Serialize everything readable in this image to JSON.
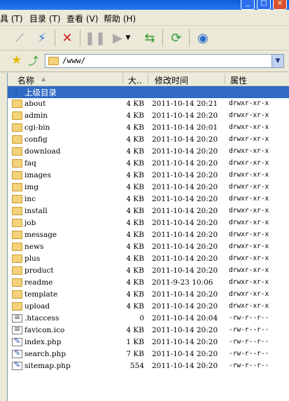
{
  "menu": [
    "具 (T)",
    "目录 (T)",
    "查看 (V)",
    "帮助 (H)"
  ],
  "address": {
    "path": "/www/"
  },
  "columns": {
    "name": "名称",
    "size": "大..",
    "time": "修改时间",
    "attr": "属性"
  },
  "parent_label": "上级目录",
  "files": [
    {
      "name": "about",
      "size": "4 KB",
      "time": "2011-10-14 20:21",
      "attr": "drwxr-xr-x",
      "type": "folder"
    },
    {
      "name": "admin",
      "size": "4 KB",
      "time": "2011-10-14 20:20",
      "attr": "drwxr-xr-x",
      "type": "folder"
    },
    {
      "name": "cgi-bin",
      "size": "4 KB",
      "time": "2011-10-14 20:01",
      "attr": "drwxr-xr-x",
      "type": "folder"
    },
    {
      "name": "config",
      "size": "4 KB",
      "time": "2011-10-14 20:20",
      "attr": "drwxr-xr-x",
      "type": "folder"
    },
    {
      "name": "download",
      "size": "4 KB",
      "time": "2011-10-14 20:20",
      "attr": "drwxr-xr-x",
      "type": "folder"
    },
    {
      "name": "faq",
      "size": "4 KB",
      "time": "2011-10-14 20:20",
      "attr": "drwxr-xr-x",
      "type": "folder"
    },
    {
      "name": "images",
      "size": "4 KB",
      "time": "2011-10-14 20:20",
      "attr": "drwxr-xr-x",
      "type": "folder"
    },
    {
      "name": "img",
      "size": "4 KB",
      "time": "2011-10-14 20:20",
      "attr": "drwxr-xr-x",
      "type": "folder"
    },
    {
      "name": "inc",
      "size": "4 KB",
      "time": "2011-10-14 20:20",
      "attr": "drwxr-xr-x",
      "type": "folder"
    },
    {
      "name": "install",
      "size": "4 KB",
      "time": "2011-10-14 20:20",
      "attr": "drwxr-xr-x",
      "type": "folder"
    },
    {
      "name": "job",
      "size": "4 KB",
      "time": "2011-10-14 20:20",
      "attr": "drwxr-xr-x",
      "type": "folder"
    },
    {
      "name": "message",
      "size": "4 KB",
      "time": "2011-10-14 20:20",
      "attr": "drwxr-xr-x",
      "type": "folder"
    },
    {
      "name": "news",
      "size": "4 KB",
      "time": "2011-10-14 20:20",
      "attr": "drwxr-xr-x",
      "type": "folder"
    },
    {
      "name": "plus",
      "size": "4 KB",
      "time": "2011-10-14 20:20",
      "attr": "drwxr-xr-x",
      "type": "folder"
    },
    {
      "name": "product",
      "size": "4 KB",
      "time": "2011-10-14 20:20",
      "attr": "drwxr-xr-x",
      "type": "folder"
    },
    {
      "name": "readme",
      "size": "4 KB",
      "time": "2011-9-23 10:06",
      "attr": "drwxr-xr-x",
      "type": "folder"
    },
    {
      "name": "template",
      "size": "4 KB",
      "time": "2011-10-14 20:20",
      "attr": "drwxr-xr-x",
      "type": "folder"
    },
    {
      "name": "upload",
      "size": "4 KB",
      "time": "2011-10-14 20:20",
      "attr": "drwxr-xr-x",
      "type": "folder"
    },
    {
      "name": ".htaccess",
      "size": "0",
      "time": "2011-10-14 20:04",
      "attr": "-rw-r--r--",
      "type": "txt"
    },
    {
      "name": "favicon.ico",
      "size": "4 KB",
      "time": "2011-10-14 20:20",
      "attr": "-rw-r--r--",
      "type": "txt"
    },
    {
      "name": "index.php",
      "size": "1 KB",
      "time": "2011-10-14 20:20",
      "attr": "-rw-r--r--",
      "type": "php"
    },
    {
      "name": "search.php",
      "size": "7 KB",
      "time": "2011-10-14 20:20",
      "attr": "-rw-r--r--",
      "type": "php"
    },
    {
      "name": "sitemap.php",
      "size": "554",
      "time": "2011-10-14 20:20",
      "attr": "-rw-r--r--",
      "type": "php"
    }
  ],
  "icons": {
    "toolbar": [
      "disconnect-icon",
      "connect-icon",
      "delete-icon",
      "pause-icon",
      "skip-icon",
      "transfer-icon",
      "refresh-icon",
      "site-manager-icon"
    ],
    "address": [
      "favorite-star-icon",
      "up-level-icon",
      "folder-icon"
    ]
  }
}
